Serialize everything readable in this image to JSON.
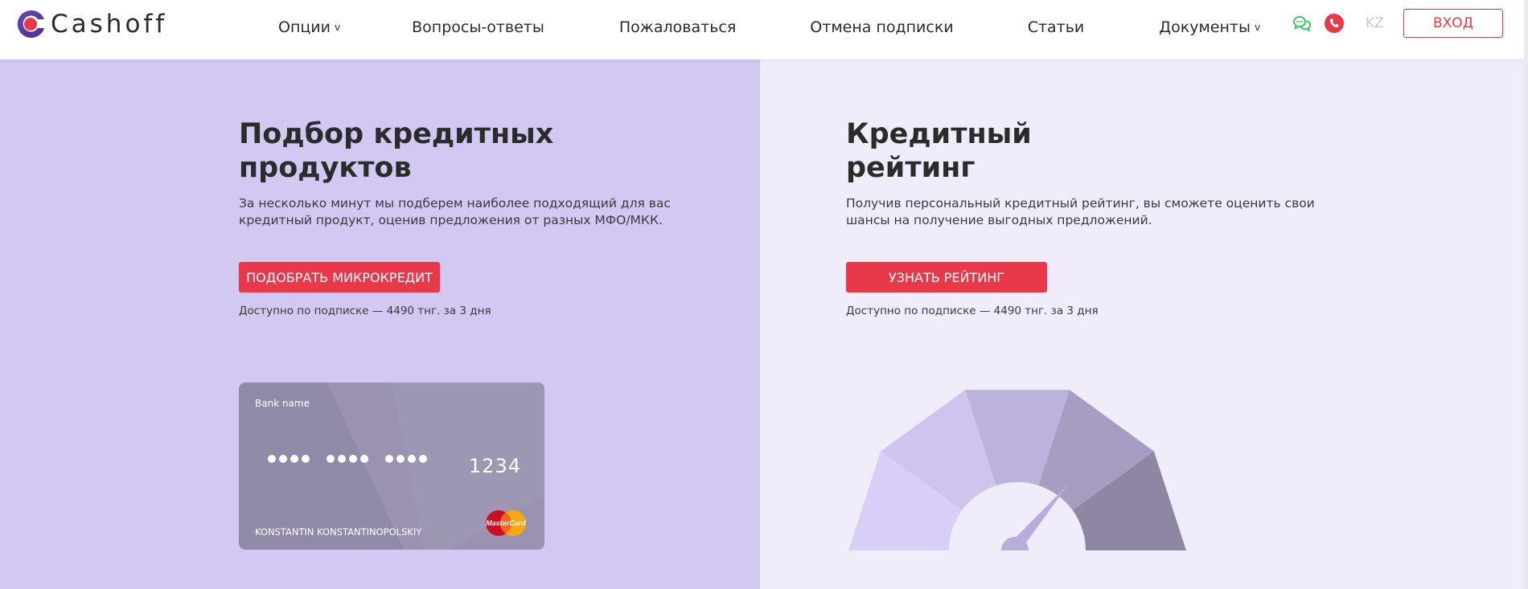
{
  "header": {
    "logo_text": "Cashoff",
    "nav": [
      {
        "label": "Опции",
        "has_dropdown": true
      },
      {
        "label": "Вопросы-ответы",
        "has_dropdown": false
      },
      {
        "label": "Пожаловаться",
        "has_dropdown": false
      },
      {
        "label": "Отмена подписки",
        "has_dropdown": false
      },
      {
        "label": "Статьи",
        "has_dropdown": false
      },
      {
        "label": "Документы",
        "has_dropdown": true
      }
    ],
    "dropdown_caret": "v",
    "icons": {
      "chat": "chat-icon",
      "phone": "phone-icon"
    },
    "lang": "KZ",
    "login_label": "ВХОД"
  },
  "left_panel": {
    "title": "Подбор кредитных\nпродуктов",
    "description": "За несколько минут мы подберем наиболее подходящий для вас кредитный продукт, оценив предложения от разных МФО/МКК.",
    "button_label": "ПОДОБРАТЬ МИКРОКРЕДИТ",
    "note": "Доступно по подписке — 4490 тнг. за 3 дня",
    "card": {
      "bank_name": "Bank name",
      "number_last4": "1234",
      "holder": "KONSTANTIN KONSTANTINOPOLSKIY",
      "network_logo": "MasterCard"
    }
  },
  "right_panel": {
    "title": "Кредитный\nрейтинг",
    "description": "Получив персональный кредитный рейтинг, вы сможете оценить свои шансы на получение выгодных предложений.",
    "button_label": "УЗНАТЬ РЕЙТИНГ",
    "note": "Доступно по подписке — 4490 тнг. за 3 дня",
    "gauge": {
      "segment_colors": [
        "#d8cef6",
        "#cfc4ee",
        "#bdb2dd",
        "#a79dc1",
        "#8f86a3"
      ],
      "needle_color": "#b8adda"
    }
  },
  "colors": {
    "accent": "#e8394a",
    "left_bg": "#d3c8f2",
    "right_bg": "#f0ecfc",
    "chat_icon": "#2ec35d",
    "lang": "#c9c0eb",
    "card": "#9189a8"
  }
}
